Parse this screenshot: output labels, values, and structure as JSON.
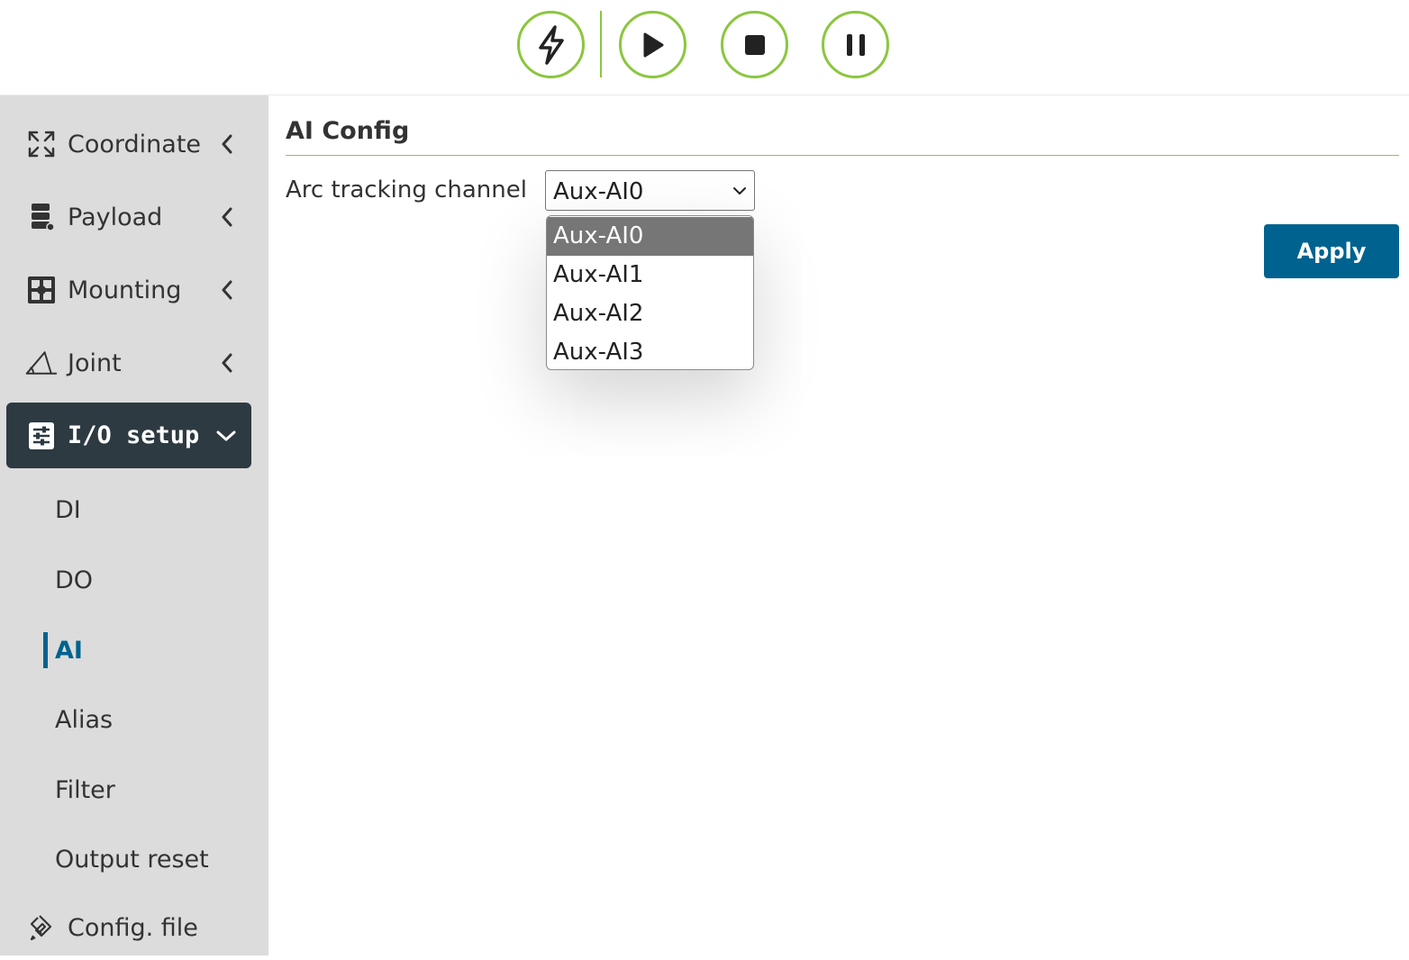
{
  "toolbar": {
    "buttons": [
      {
        "name": "power-icon"
      },
      {
        "name": "play-icon"
      },
      {
        "name": "stop-icon"
      },
      {
        "name": "pause-icon"
      }
    ],
    "accent_color": "#8cc63f"
  },
  "sidebar": {
    "items": [
      {
        "label": "Coordinate",
        "icon": "expand-arrows-icon"
      },
      {
        "label": "Payload",
        "icon": "payload-icon"
      },
      {
        "label": "Mounting",
        "icon": "mounting-icon"
      },
      {
        "label": "Joint",
        "icon": "angle-icon"
      },
      {
        "label": "I/O setup",
        "icon": "sliders-icon",
        "active": true
      },
      {
        "label": "Config. file",
        "icon": "config-file-icon"
      }
    ],
    "subitems": [
      {
        "label": "DI"
      },
      {
        "label": "DO"
      },
      {
        "label": "AI",
        "current": true
      },
      {
        "label": "Alias"
      },
      {
        "label": "Filter"
      },
      {
        "label": "Output reset"
      }
    ],
    "active_color": "#2d3a42",
    "current_color": "#00638f"
  },
  "main": {
    "title": "AI Config",
    "field_label": "Arc tracking channel",
    "select": {
      "value": "Aux-AI0",
      "options": [
        "Aux-AI0",
        "Aux-AI1",
        "Aux-AI2",
        "Aux-AI3"
      ],
      "selected_index": 0
    },
    "apply_label": "Apply",
    "apply_color": "#00638f"
  }
}
